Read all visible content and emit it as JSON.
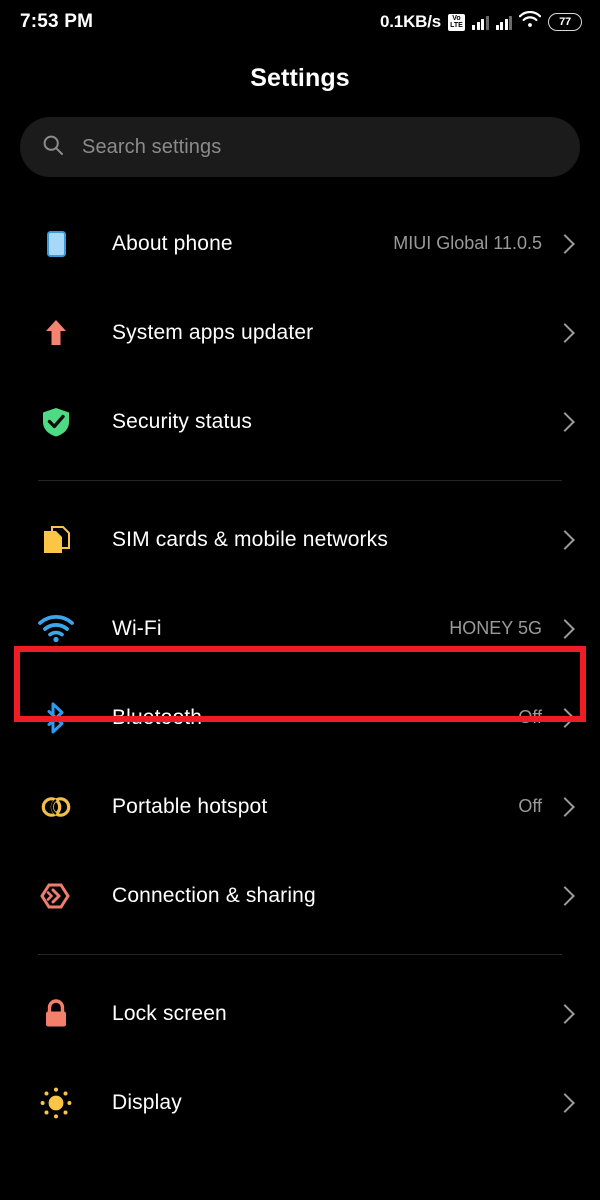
{
  "status_bar": {
    "time": "7:53 PM",
    "net_speed": "0.1KB/s",
    "volte_top": "Vo",
    "volte_bottom": "LTE",
    "volte_icon": "volte-icon",
    "signal_1_icon": "signal-bars-icon",
    "signal_2_icon": "signal-bars-icon",
    "wifi_icon": "wifi-icon",
    "battery_level": "77",
    "battery_icon": "battery-icon"
  },
  "header": {
    "title": "Settings"
  },
  "search": {
    "icon": "search-icon",
    "placeholder": "Search settings",
    "value": ""
  },
  "groups": [
    {
      "items": [
        {
          "name": "about-phone",
          "label": "About phone",
          "value": "MIUI Global 11.0.5",
          "icon": "phone-icon",
          "icon_color": "#9ed4f7",
          "chevron": "chevron-right-icon"
        },
        {
          "name": "system-apps-updater",
          "label": "System apps updater",
          "value": "",
          "icon": "up-arrow-icon",
          "icon_color": "#f4836f",
          "chevron": "chevron-right-icon"
        },
        {
          "name": "security-status",
          "label": "Security status",
          "value": "",
          "icon": "shield-check-icon",
          "icon_color": "#4ddb84",
          "chevron": "chevron-right-icon"
        }
      ]
    },
    {
      "items": [
        {
          "name": "sim-cards-mobile-networks",
          "label": "SIM cards & mobile networks",
          "value": "",
          "icon": "sim-card-icon",
          "icon_color": "#fbc646",
          "chevron": "chevron-right-icon"
        },
        {
          "name": "wifi",
          "label": "Wi-Fi",
          "value": "HONEY 5G",
          "icon": "wifi-icon",
          "icon_color": "#3ba7ea",
          "chevron": "chevron-right-icon",
          "highlighted": true
        },
        {
          "name": "bluetooth",
          "label": "Bluetooth",
          "value": "Off",
          "icon": "bluetooth-icon",
          "icon_color": "#2f9bf0",
          "chevron": "chevron-right-icon"
        },
        {
          "name": "portable-hotspot",
          "label": "Portable hotspot",
          "value": "Off",
          "icon": "hotspot-rings-icon",
          "icon_color": "#f0c04a",
          "chevron": "chevron-right-icon"
        },
        {
          "name": "connection-sharing",
          "label": "Connection & sharing",
          "value": "",
          "icon": "connection-sharing-icon",
          "icon_color": "#ef7f6c",
          "chevron": "chevron-right-icon"
        }
      ]
    },
    {
      "items": [
        {
          "name": "lock-screen",
          "label": "Lock screen",
          "value": "",
          "icon": "lock-icon",
          "icon_color": "#f4806c",
          "chevron": "chevron-right-icon"
        },
        {
          "name": "display",
          "label": "Display",
          "value": "",
          "icon": "sun-brightness-icon",
          "icon_color": "#fbc646",
          "chevron": "chevron-right-icon"
        }
      ]
    }
  ],
  "highlight": {
    "color": "#ee1c24",
    "target": "wifi"
  }
}
